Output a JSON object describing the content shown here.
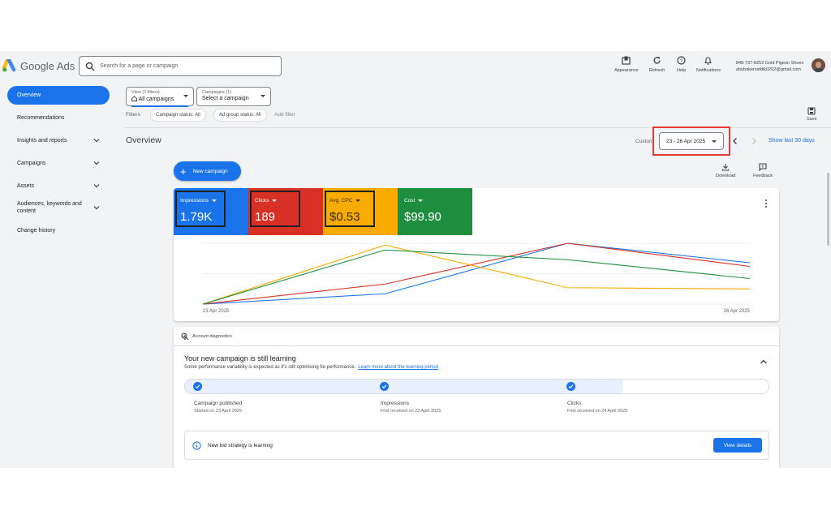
{
  "header": {
    "brand": "Google Ads",
    "search_placeholder": "Search for a page or campaign",
    "buttons": [
      {
        "label": "Appearance",
        "icon": "appearance-icon"
      },
      {
        "label": "Refresh",
        "icon": "refresh-icon"
      },
      {
        "label": "Help",
        "icon": "help-icon"
      },
      {
        "label": "Notifications",
        "icon": "bell-icon"
      }
    ],
    "account_line1": "848-737-8252 Gold Pigeon Shoes",
    "account_line2": "abubakersiddik0202@gmail.com"
  },
  "sidebar": {
    "items": [
      {
        "label": "Overview",
        "active": true
      },
      {
        "label": "Recommendations"
      },
      {
        "label": "Insights and reports",
        "expandable": true
      },
      {
        "label": "Campaigns",
        "expandable": true
      },
      {
        "label": "Assets",
        "expandable": true
      },
      {
        "label": "Audiences, keywords and content",
        "expandable": true
      },
      {
        "label": "Change history"
      }
    ]
  },
  "toolbar": {
    "view_small": "View (2 filters)",
    "view_value": "All campaigns",
    "campaigns_small": "Campaigns (1)",
    "campaigns_value": "Select a campaign",
    "filters_label": "Filters",
    "filter_chips": [
      "Campaign status: All",
      "Ad group status: All"
    ],
    "add_filter": "Add filter",
    "save_label": "Save"
  },
  "overview": {
    "title": "Overview",
    "custom_label": "Custom",
    "date_range": "23 - 26 Apr 2025",
    "show_last": "Show last 30 days",
    "new_campaign": "New campaign",
    "download": "Download",
    "feedback": "Feedback"
  },
  "metrics": [
    {
      "label": "Impressions",
      "value": "1.79K",
      "color": "#1a73e8"
    },
    {
      "label": "Clicks",
      "value": "189",
      "color": "#d93025"
    },
    {
      "label": "Avg. CPC",
      "value": "$0.53",
      "color": "#f9ab00"
    },
    {
      "label": "Cost",
      "value": "$99.90",
      "color": "#1e8e3e"
    }
  ],
  "chart_data": {
    "type": "line",
    "x": [
      "23 Apr 2025",
      "24 Apr 2025",
      "25 Apr 2025",
      "26 Apr 2025"
    ],
    "x_tick_labels": [
      "23 Apr 2025",
      "26 Apr 2025"
    ],
    "normalized": true,
    "ylim": [
      0,
      1
    ],
    "grid": true,
    "series": [
      {
        "name": "Impressions",
        "color": "#1a73e8",
        "values": [
          0.0,
          0.17,
          1.0,
          0.68
        ]
      },
      {
        "name": "Clicks",
        "color": "#d93025",
        "values": [
          0.0,
          0.33,
          1.0,
          0.62
        ]
      },
      {
        "name": "Avg. CPC",
        "color": "#f9ab00",
        "values": [
          0.0,
          0.97,
          0.27,
          0.25
        ]
      },
      {
        "name": "Cost",
        "color": "#1e8e3e",
        "values": [
          0.0,
          0.89,
          0.73,
          0.42
        ]
      }
    ]
  },
  "diagnostics": {
    "header": "Account diagnostics",
    "title": "Your new campaign is still learning",
    "subtitle": "Some performance variability is expected as it's still optimising for performance.",
    "link": "Learn more about the learning period",
    "progress_fraction": 0.75,
    "steps": [
      {
        "name": "Campaign published",
        "sub": "Started on 23 April 2025"
      },
      {
        "name": "Impressions",
        "sub": "First received on 23 April 2025"
      },
      {
        "name": "Clicks",
        "sub": "First received on 24 April 2025"
      }
    ],
    "bid_text": "New bid strategy is learning",
    "view_details": "View details"
  }
}
